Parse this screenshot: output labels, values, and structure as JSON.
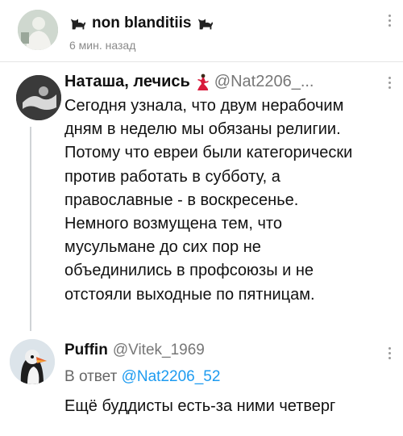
{
  "header": {
    "author_name": "non blanditiis",
    "time": "6 мин. назад",
    "icons": [
      "cat-icon",
      "cat-icon",
      "more-vertical-icon"
    ]
  },
  "tweet": {
    "author_name": "Наташа, лечись",
    "author_emoji": "dancer-icon",
    "handle": "@Nat2206_...",
    "text": "Сегодня узнала, что двум нерабочим\nдням в неделю мы обязаны религии.\nПотому что евреи были категорически\nпротив работать в субботу, а\nправославные - в воскресенье.\nНемного возмущена тем, что\nмусульмане до сих пор не\nобъединились в профсоюзы и не\nотстояли выходные по пятницам."
  },
  "reply": {
    "author_name": "Puffin",
    "handle": "@Vitek_1969",
    "reply_prefix": "В ответ",
    "reply_to": "@Nat2206_52",
    "text": "Ещё буддисты есть-за ними четверг"
  },
  "colors": {
    "mention": "#1d9bf0",
    "secondary_text": "#777777",
    "thread_line": "#cfd3d6"
  }
}
